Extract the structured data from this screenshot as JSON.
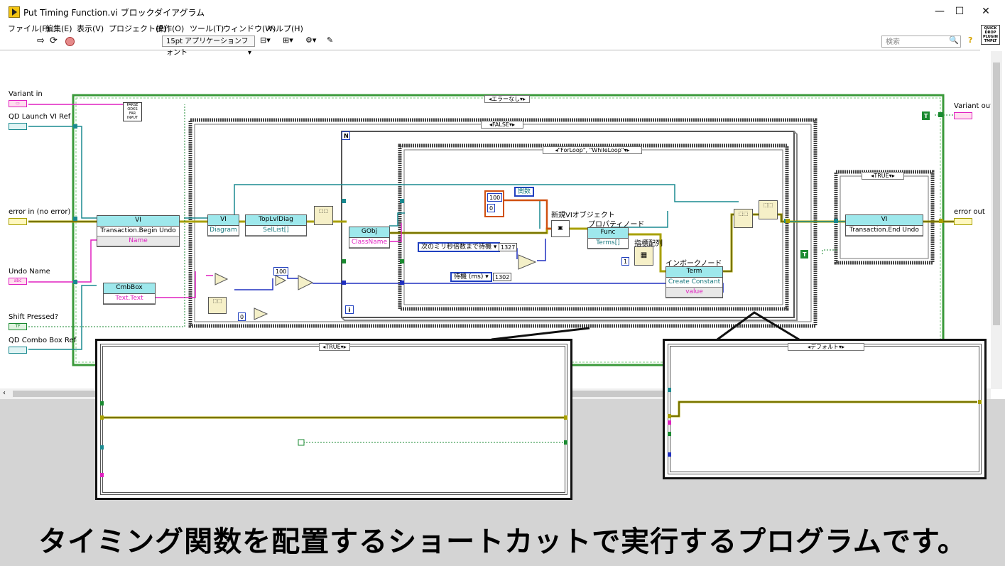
{
  "window": {
    "title": "Put Timing Function.vi ブロックダイアグラム",
    "minimize": "—",
    "maximize": "☐",
    "close": "✕"
  },
  "menu": [
    "ファイル(F)",
    "編集(E)",
    "表示(V)",
    "プロジェクト(P)",
    "操作(O)",
    "ツール(T)",
    "ウィンドウ(W)",
    "ヘルプ(H)"
  ],
  "toolbar": {
    "font_select": "15pt アプリケーションフォント",
    "search_placeholder": "検索",
    "help": "?",
    "qd_badge": "QUICK DROP PLUGIN TMPLT"
  },
  "diagram": {
    "controls": {
      "variant_in": "Variant in",
      "qd_launch_vi_ref": "QD Launch VI Ref",
      "error_in": "error in (no error)",
      "undo_name": "Undo Name",
      "shift_pressed": "Shift Pressed?",
      "qd_combo_box_ref": "QD Combo Box Ref",
      "variant_out": "Variant out",
      "error_out": "error out"
    },
    "case_outer": "エラーなし",
    "case_false": "FALSE",
    "case_loops": "\"ForLoop\", \"WhileLoop\"",
    "case_true": "TRUE",
    "parse_odks": "PARSE ODKS FAR INPUT",
    "loop_n": "N",
    "loop_i": "i",
    "nodes": {
      "begin_undo_head": "VI",
      "begin_undo_method": "Transaction.Begin Undo",
      "begin_undo_prop": "Name",
      "diagram_head": "VI",
      "diagram_prop": "Diagram",
      "toplvl_head": "TopLvlDiag",
      "toplvl_prop": "SelList[]",
      "gobj_head": "GObj",
      "gobj_prop": "ClassName",
      "cmbbox_head": "CmbBox",
      "cmbbox_prop": "Text.Text",
      "func_head": "Func",
      "func_prop": "Terms[]",
      "term_head": "Term",
      "term_method": "Create Constant",
      "term_prop": "value",
      "end_undo_head": "VI",
      "end_undo_method": "Transaction.End Undo"
    },
    "labels": {
      "new_vi_object": "新規VIオブジェクト",
      "property_node": "プロパティノード",
      "index_array": "指標配列",
      "invoke_node": "インボークノード",
      "function_const": "関数"
    },
    "constants": {
      "c100a": "100",
      "c0a": "0",
      "c100b": "100",
      "c0b": "0",
      "c1": "1",
      "ring1": "次のミリ秒倍数まで待機",
      "ring1_val": "1327",
      "ring2": "待機 (ms)",
      "ring2_val": "1302",
      "t_const": "T",
      "t_const2": "T"
    }
  },
  "zoom_left": {
    "case": "TRUE"
  },
  "zoom_right": {
    "case": "デフォルト"
  },
  "caption": "タイミング関数を配置するショートカットで実行するプログラムです。"
}
